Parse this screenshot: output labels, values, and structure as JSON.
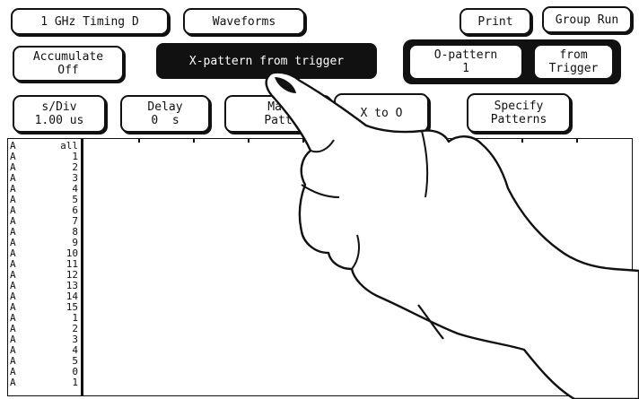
{
  "toolbar": {
    "timing_menu": "1 GHz Timing D",
    "waveforms_menu": "Waveforms",
    "print": "Print",
    "group_run": "Group Run"
  },
  "controls": {
    "accumulate": {
      "line1": "Accumulate",
      "line2": "Off"
    },
    "x_pattern": "X-pattern from trigger",
    "o_pattern": {
      "line1": "O-pattern",
      "line2": "1"
    },
    "from_trigger": {
      "line1": "from",
      "line2": "Trigger"
    }
  },
  "settings": {
    "s_div": {
      "label": "s/Div",
      "value": "1.00 us"
    },
    "delay": {
      "label": "Delay",
      "value": "0  s"
    },
    "markers": {
      "line1": "Mar",
      "line2": "Patt"
    },
    "x_to_o": {
      "line1": "X to O",
      "line2": ""
    },
    "specify": {
      "line1": "Specify",
      "line2": "Patterns"
    }
  },
  "channels": [
    {
      "pod": "A",
      "bit": "all"
    },
    {
      "pod": "A",
      "bit": "1"
    },
    {
      "pod": "A",
      "bit": "2"
    },
    {
      "pod": "A",
      "bit": "3"
    },
    {
      "pod": "A",
      "bit": "4"
    },
    {
      "pod": "A",
      "bit": "5"
    },
    {
      "pod": "A",
      "bit": "6"
    },
    {
      "pod": "A",
      "bit": "7"
    },
    {
      "pod": "A",
      "bit": "8"
    },
    {
      "pod": "A",
      "bit": "9"
    },
    {
      "pod": "A",
      "bit": "10"
    },
    {
      "pod": "A",
      "bit": "11"
    },
    {
      "pod": "A",
      "bit": "12"
    },
    {
      "pod": "A",
      "bit": "13"
    },
    {
      "pod": "A",
      "bit": "14"
    },
    {
      "pod": "A",
      "bit": "15"
    },
    {
      "pod": "A",
      "bit": "1"
    },
    {
      "pod": "A",
      "bit": "2"
    },
    {
      "pod": "A",
      "bit": "3"
    },
    {
      "pod": "A",
      "bit": "4"
    },
    {
      "pod": "A",
      "bit": "5"
    },
    {
      "pod": "A",
      "bit": "0"
    },
    {
      "pod": "A",
      "bit": "1"
    }
  ]
}
